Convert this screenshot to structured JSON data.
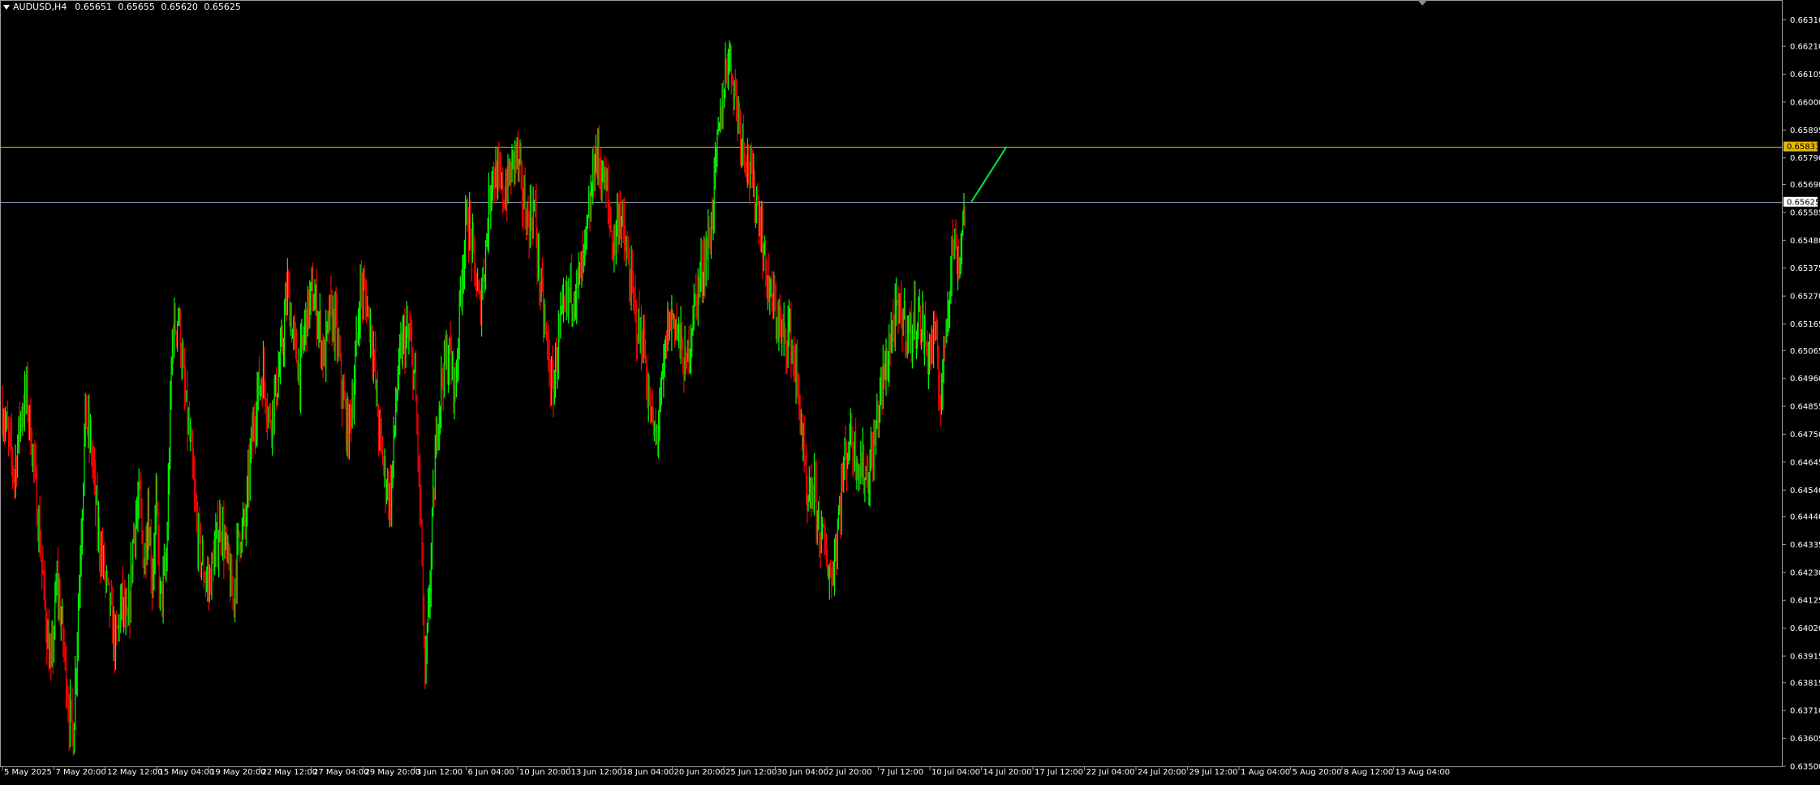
{
  "header": {
    "symbol": "AUDUSD,H4",
    "open": "0.65651",
    "high": "0.65655",
    "low": "0.65620",
    "close": "0.65625"
  },
  "chart_data": {
    "type": "candlestick",
    "symbol": "AUDUSD",
    "timeframe": "H4",
    "bull_color": "#00ff00",
    "bear_color": "#ff0000",
    "background": "#000000",
    "grid": false,
    "ylim": [
      0.635,
      0.6636
    ],
    "y_ticks": [
      "0.66310",
      "0.66210",
      "0.66105",
      "0.66000",
      "0.65895",
      "0.65790",
      "0.65690",
      "0.65585",
      "0.65480",
      "0.65375",
      "0.65270",
      "0.65165",
      "0.65065",
      "0.64960",
      "0.64855",
      "0.64750",
      "0.64645",
      "0.64540",
      "0.64440",
      "0.64335",
      "0.64230",
      "0.64125",
      "0.64020",
      "0.63915",
      "0.63815",
      "0.63710",
      "0.63605",
      "0.63500"
    ],
    "x_ticks": [
      "5 May 2025",
      "7 May 20:00",
      "12 May 12:00",
      "15 May 04:00",
      "19 May 20:00",
      "22 May 12:00",
      "27 May 04:00",
      "29 May 20:00",
      "3 Jun 12:00",
      "6 Jun 04:00",
      "10 Jun 20:00",
      "13 Jun 12:00",
      "18 Jun 04:00",
      "20 Jun 20:00",
      "25 Jun 12:00",
      "30 Jun 04:00",
      "2 Jul 20:00",
      "7 Jul 12:00",
      "10 Jul 04:00",
      "14 Jul 20:00",
      "17 Jul 12:00",
      "22 Jul 04:00",
      "24 Jul 20:00",
      "29 Jul 12:00",
      "1 Aug 04:00",
      "5 Aug 20:00",
      "8 Aug 12:00",
      "13 Aug 04:00"
    ],
    "horizontal_lines": [
      {
        "label": "0.65833",
        "value": 0.65833,
        "color": "#e6b800"
      },
      {
        "label": "0.65625",
        "value": 0.65625,
        "color": "#8a9ab8"
      }
    ],
    "close_path": [
      [
        0,
        0.6485
      ],
      [
        6,
        0.6472
      ],
      [
        12,
        0.646
      ],
      [
        18,
        0.6482
      ],
      [
        24,
        0.649
      ],
      [
        30,
        0.6468
      ],
      [
        36,
        0.644
      ],
      [
        42,
        0.641
      ],
      [
        48,
        0.6385
      ],
      [
        54,
        0.642
      ],
      [
        60,
        0.6398
      ],
      [
        66,
        0.637
      ],
      [
        70,
        0.6362
      ],
      [
        76,
        0.642
      ],
      [
        82,
        0.6482
      ],
      [
        88,
        0.647
      ],
      [
        94,
        0.644
      ],
      [
        100,
        0.6425
      ],
      [
        106,
        0.641
      ],
      [
        112,
        0.6395
      ],
      [
        118,
        0.6412
      ],
      [
        124,
        0.64
      ],
      [
        130,
        0.644
      ],
      [
        136,
        0.645
      ],
      [
        140,
        0.6425
      ],
      [
        144,
        0.6448
      ],
      [
        148,
        0.642
      ],
      [
        152,
        0.6448
      ],
      [
        156,
        0.6412
      ],
      [
        162,
        0.6425
      ],
      [
        168,
        0.6512
      ],
      [
        174,
        0.652
      ],
      [
        180,
        0.649
      ],
      [
        186,
        0.647
      ],
      [
        192,
        0.644
      ],
      [
        198,
        0.6425
      ],
      [
        204,
        0.6418
      ],
      [
        210,
        0.643
      ],
      [
        216,
        0.6442
      ],
      [
        222,
        0.6428
      ],
      [
        228,
        0.6412
      ],
      [
        234,
        0.6438
      ],
      [
        240,
        0.644
      ],
      [
        246,
        0.647
      ],
      [
        252,
        0.649
      ],
      [
        258,
        0.6498
      ],
      [
        264,
        0.648
      ],
      [
        270,
        0.649
      ],
      [
        276,
        0.6505
      ],
      [
        282,
        0.653
      ],
      [
        288,
        0.651
      ],
      [
        294,
        0.6498
      ],
      [
        300,
        0.6518
      ],
      [
        306,
        0.6528
      ],
      [
        312,
        0.652
      ],
      [
        318,
        0.6503
      ],
      [
        324,
        0.652
      ],
      [
        330,
        0.6515
      ],
      [
        336,
        0.649
      ],
      [
        342,
        0.6475
      ],
      [
        348,
        0.6495
      ],
      [
        354,
        0.653
      ],
      [
        360,
        0.6525
      ],
      [
        366,
        0.651
      ],
      [
        372,
        0.6478
      ],
      [
        378,
        0.646
      ],
      [
        384,
        0.645
      ],
      [
        390,
        0.6492
      ],
      [
        396,
        0.651
      ],
      [
        402,
        0.6512
      ],
      [
        408,
        0.6495
      ],
      [
        414,
        0.644
      ],
      [
        418,
        0.638
      ],
      [
        424,
        0.643
      ],
      [
        430,
        0.648
      ],
      [
        436,
        0.65
      ],
      [
        442,
        0.6505
      ],
      [
        448,
        0.6492
      ],
      [
        454,
        0.6535
      ],
      [
        460,
        0.6558
      ],
      [
        466,
        0.654
      ],
      [
        472,
        0.6522
      ],
      [
        478,
        0.6545
      ],
      [
        484,
        0.6575
      ],
      [
        490,
        0.657
      ],
      [
        496,
        0.6565
      ],
      [
        502,
        0.6572
      ],
      [
        508,
        0.6582
      ],
      [
        514,
        0.6565
      ],
      [
        520,
        0.6555
      ],
      [
        526,
        0.656
      ],
      [
        532,
        0.653
      ],
      [
        538,
        0.651
      ],
      [
        544,
        0.649
      ],
      [
        550,
        0.6512
      ],
      [
        556,
        0.652
      ],
      [
        562,
        0.653
      ],
      [
        568,
        0.653
      ],
      [
        574,
        0.6538
      ],
      [
        580,
        0.6555
      ],
      [
        586,
        0.658
      ],
      [
        592,
        0.6575
      ],
      [
        598,
        0.6565
      ],
      [
        604,
        0.6545
      ],
      [
        610,
        0.656
      ],
      [
        616,
        0.6545
      ],
      [
        622,
        0.653
      ],
      [
        628,
        0.6515
      ],
      [
        634,
        0.651
      ],
      [
        640,
        0.6485
      ],
      [
        646,
        0.6472
      ],
      [
        652,
        0.649
      ],
      [
        658,
        0.6515
      ],
      [
        664,
        0.652
      ],
      [
        670,
        0.651
      ],
      [
        676,
        0.6498
      ],
      [
        682,
        0.6518
      ],
      [
        688,
        0.653
      ],
      [
        694,
        0.654
      ],
      [
        700,
        0.655
      ],
      [
        706,
        0.6578
      ],
      [
        712,
        0.66
      ],
      [
        718,
        0.662
      ],
      [
        724,
        0.6605
      ],
      [
        730,
        0.659
      ],
      [
        736,
        0.658
      ],
      [
        742,
        0.6568
      ],
      [
        748,
        0.656
      ],
      [
        754,
        0.654
      ],
      [
        760,
        0.6525
      ],
      [
        766,
        0.652
      ],
      [
        772,
        0.651
      ],
      [
        778,
        0.6515
      ],
      [
        784,
        0.65
      ],
      [
        790,
        0.648
      ],
      [
        796,
        0.6445
      ],
      [
        802,
        0.6455
      ],
      [
        808,
        0.644
      ],
      [
        814,
        0.643
      ],
      [
        820,
        0.642
      ],
      [
        826,
        0.644
      ],
      [
        832,
        0.6462
      ],
      [
        838,
        0.6475
      ],
      [
        844,
        0.6468
      ],
      [
        850,
        0.6462
      ],
      [
        856,
        0.646
      ],
      [
        862,
        0.647
      ],
      [
        868,
        0.649
      ],
      [
        874,
        0.65
      ],
      [
        880,
        0.6515
      ],
      [
        886,
        0.652
      ],
      [
        892,
        0.6518
      ],
      [
        898,
        0.6512
      ],
      [
        904,
        0.652
      ],
      [
        910,
        0.6515
      ],
      [
        916,
        0.6505
      ],
      [
        922,
        0.6512
      ],
      [
        928,
        0.6488
      ],
      [
        934,
        0.652
      ],
      [
        940,
        0.6548
      ],
      [
        946,
        0.654
      ],
      [
        952,
        0.6562
      ]
    ],
    "projection": {
      "color": "#00e640",
      "from": [
        952,
        0.65625
      ],
      "to": [
        982,
        0.65833
      ]
    }
  }
}
